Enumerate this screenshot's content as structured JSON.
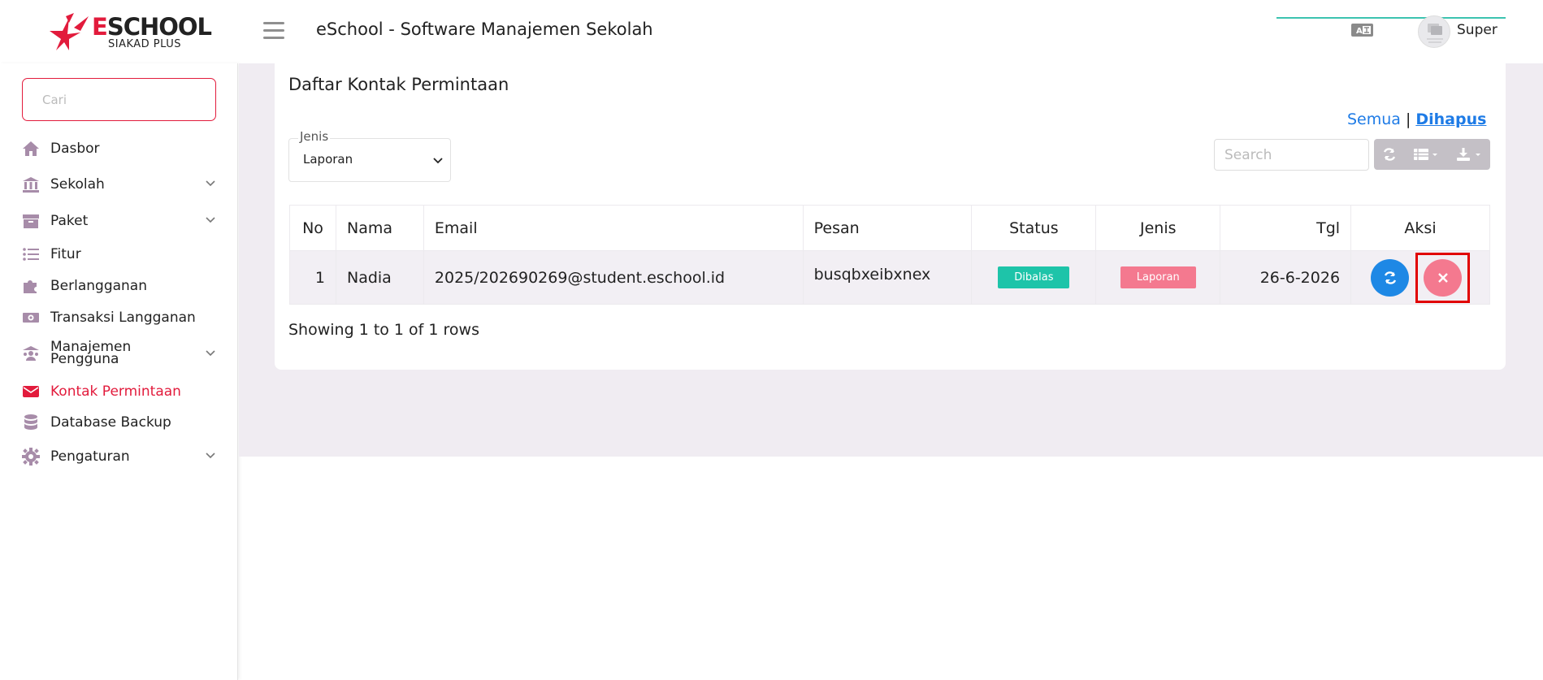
{
  "brand": {
    "title_e": "E",
    "title_rest": "SCHOOL",
    "subtitle": "SIAKAD PLUS",
    "primary_color": "#e21b3c"
  },
  "header": {
    "app_title": "eSchool - Software Manajemen Sekolah",
    "username": "Super",
    "menu_icon": "hamburger-icon",
    "lang_icon": "language-icon"
  },
  "sidebar": {
    "search_placeholder": "Cari",
    "items": [
      {
        "label": "Dasbor",
        "icon": "home-icon",
        "has_children": false
      },
      {
        "label": "Sekolah",
        "icon": "school-icon",
        "has_children": true
      },
      {
        "label": "Paket",
        "icon": "archive-icon",
        "has_children": true
      },
      {
        "label": "Fitur",
        "icon": "list-icon",
        "has_children": false
      },
      {
        "label": "Berlangganan",
        "icon": "puzzle-icon",
        "has_children": false
      },
      {
        "label": "Transaksi Langganan",
        "icon": "money-icon",
        "has_children": false
      },
      {
        "label": "Manajemen Pengguna",
        "icon": "users-icon",
        "has_children": true
      },
      {
        "label": "Kontak Permintaan",
        "icon": "envelope-icon",
        "has_children": false,
        "active": true
      },
      {
        "label": "Database Backup",
        "icon": "database-icon",
        "has_children": false
      },
      {
        "label": "Pengaturan",
        "icon": "gear-icon",
        "has_children": true
      }
    ]
  },
  "main": {
    "title": "Daftar Kontak Permintaan",
    "filter_all": "Semua",
    "filter_sep": "|",
    "filter_deleted": "Dihapus",
    "select_label": "Jenis",
    "select_value": "Laporan",
    "search_placeholder": "Search",
    "columns": [
      "No",
      "Nama",
      "Email",
      "Pesan",
      "Status",
      "Jenis",
      "Tgl",
      "Aksi"
    ],
    "rows": [
      {
        "no": "1",
        "nama": "Nadia",
        "email": "2025/202690269@student.eschool.id",
        "pesan": "busqbxeibxnex",
        "status": "Dibalas",
        "jenis": "Laporan",
        "tgl": "26-6-2026"
      }
    ],
    "footer": "Showing 1 to 1 of 1 rows"
  }
}
